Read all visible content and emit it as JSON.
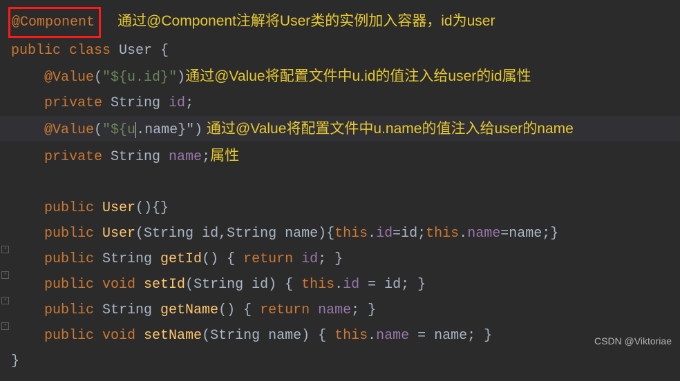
{
  "code": {
    "line1_annotation": "@Component",
    "line1_comment": "通过@Component注解将User类的实例加入容器，id为user",
    "line2_kw1": "public ",
    "line2_kw2": "class",
    "line2_classname": " User ",
    "line2_brace": "{",
    "line3_annotation": "@Value",
    "line3_paren1": "(",
    "line3_string": "\"${u.id}\"",
    "line3_paren2": ")",
    "line3_comment": "通过@Value将配置文件中u.id的值注入给user的id属性",
    "line4_kw": "private ",
    "line4_type": "String ",
    "line4_field": "id",
    "line4_semi": ";",
    "line5_annotation": "@Value",
    "line5_paren1": "(",
    "line5_string1": "\"${u",
    "line5_string2": ".name}\"",
    "line5_paren2": ")",
    "line5_comment": " 通过@Value将配置文件中u.name的值注入给user的name",
    "line6_kw": "private ",
    "line6_type": "String ",
    "line6_field": "name",
    "line6_semi": ";",
    "line6_comment": "属性",
    "line8_kw": "public ",
    "line8_method": "User",
    "line8_rest": "(){}",
    "line9_kw": "public ",
    "line9_method": "User",
    "line9_p1": "(String id,String name){",
    "line9_this1": "this",
    "line9_p2": ".",
    "line9_f1": "id",
    "line9_p3": "=id;",
    "line9_this2": "this",
    "line9_p4": ".",
    "line9_f2": "name",
    "line9_p5": "=name;}",
    "line10_kw": "public ",
    "line10_type": "String ",
    "line10_method": "getId",
    "line10_p1": "() { ",
    "line10_ret": "return ",
    "line10_field": "id",
    "line10_p2": "; }",
    "line11_kw": "public ",
    "line11_type": "void ",
    "line11_method": "setId",
    "line11_p1": "(String id) { ",
    "line11_this": "this",
    "line11_p2": ".",
    "line11_field": "id",
    "line11_p3": " = id; }",
    "line12_kw": "public ",
    "line12_type": "String ",
    "line12_method": "getName",
    "line12_p1": "() { ",
    "line12_ret": "return ",
    "line12_field": "name",
    "line12_p2": "; }",
    "line13_kw": "public ",
    "line13_type": "void ",
    "line13_method": "setName",
    "line13_p1": "(String name) { ",
    "line13_this": "this",
    "line13_p2": ".",
    "line13_field": "name",
    "line13_p3": " = name; }",
    "line14_brace": "}"
  },
  "watermark": "CSDN @Viktoriae"
}
